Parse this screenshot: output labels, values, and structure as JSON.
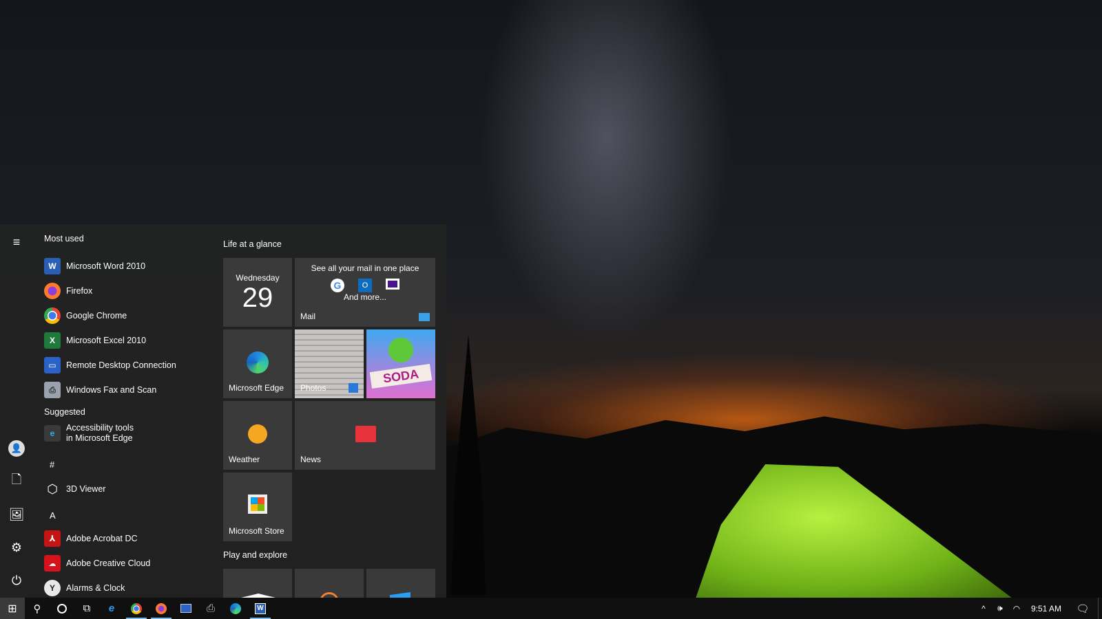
{
  "start_menu": {
    "most_used_header": "Most used",
    "most_used": [
      {
        "label": "Microsoft Word 2010",
        "icon": "word-icon",
        "color": "#2b5fb4"
      },
      {
        "label": "Firefox",
        "icon": "firefox-icon",
        "color": "#ff7a2a"
      },
      {
        "label": "Google Chrome",
        "icon": "chrome-icon",
        "color": "#3b7bea"
      },
      {
        "label": "Microsoft Excel 2010",
        "icon": "excel-icon",
        "color": "#1e7a3a"
      },
      {
        "label": "Remote Desktop Connection",
        "icon": "remote-desktop-icon",
        "color": "#2a62c8"
      },
      {
        "label": "Windows Fax and Scan",
        "icon": "fax-icon",
        "color": "#9aa3ad"
      }
    ],
    "suggested_header": "Suggested",
    "suggested": [
      {
        "label_line1": "Accessibility tools",
        "label_line2": "in Microsoft Edge"
      }
    ],
    "letter_hash": "#",
    "hash_items": [
      {
        "label": "3D Viewer"
      }
    ],
    "letter_a": "A",
    "a_items": [
      {
        "label": "Adobe Acrobat DC"
      },
      {
        "label": "Adobe Creative Cloud"
      },
      {
        "label": "Alarms & Clock"
      }
    ],
    "tiles_header_1": "Life at a glance",
    "tiles_header_2": "Play and explore",
    "calendar": {
      "day": "Wednesday",
      "date": "29"
    },
    "mail": {
      "headline": "See all your mail in one place",
      "more": "And more...",
      "label": "Mail"
    },
    "tiles": {
      "edge": "Microsoft Edge",
      "photos": "Photos",
      "candy": "SODA",
      "weather": "Weather",
      "news": "News",
      "store": "Microsoft Store"
    }
  },
  "taskbar": {
    "time": "9:51 AM",
    "accent": "#76b9ed"
  }
}
